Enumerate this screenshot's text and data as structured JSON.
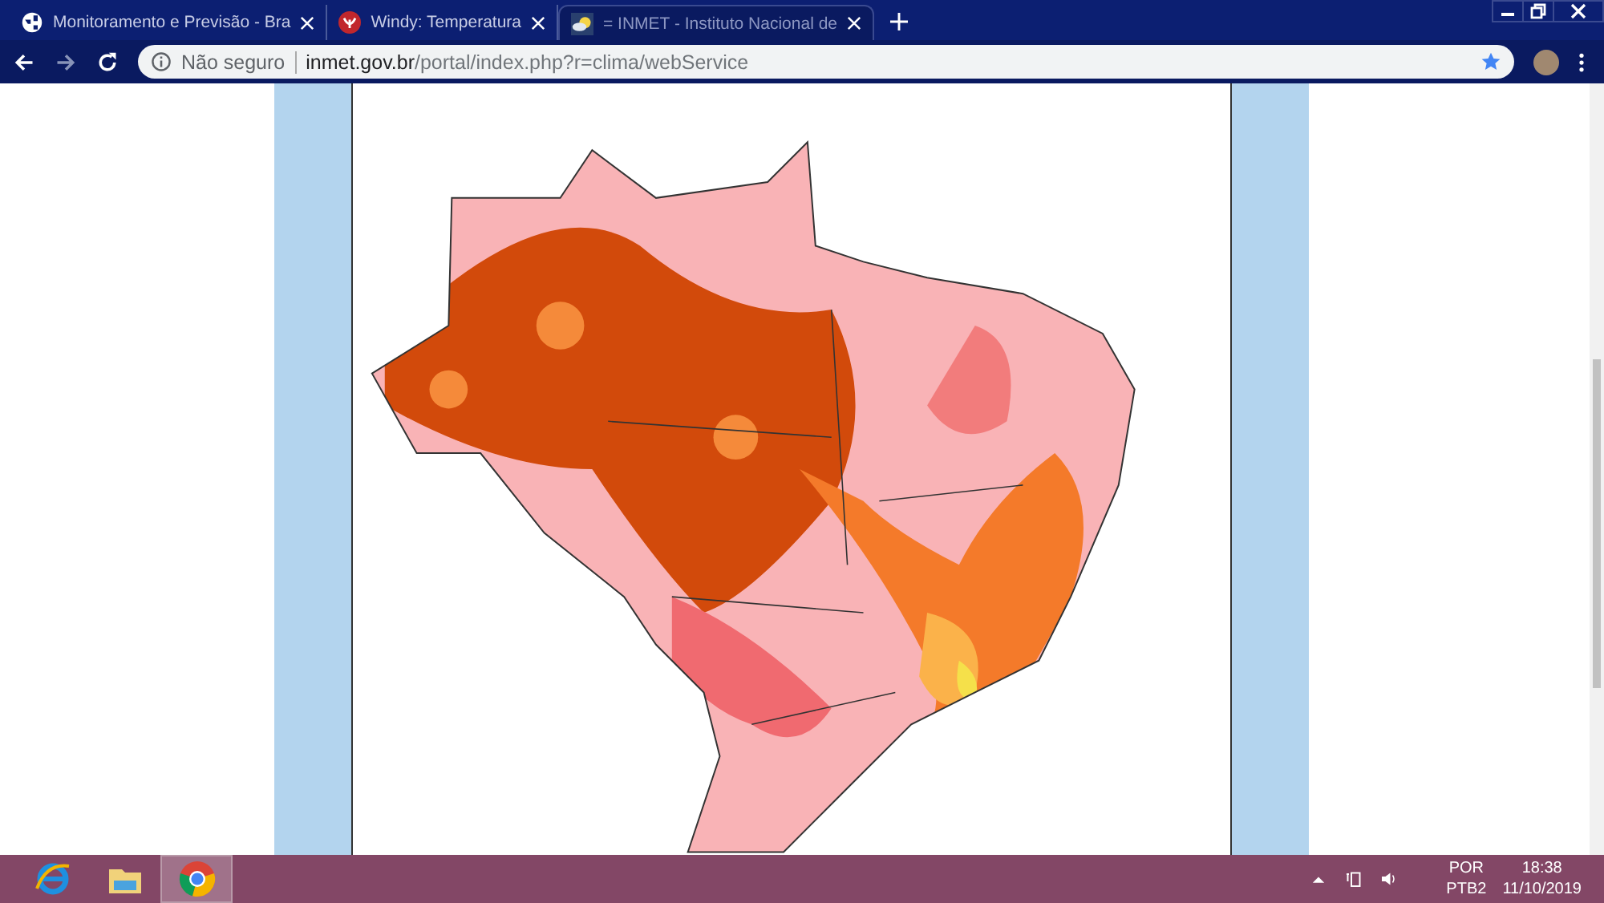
{
  "tabs": [
    {
      "title": "Monitoramento e Previsão - Bra",
      "kind": "globe",
      "selected": false
    },
    {
      "title": "Windy: Temperatura",
      "kind": "windy",
      "selected": false
    },
    {
      "title": "= INMET - Instituto Nacional de",
      "kind": "weather",
      "selected": true
    }
  ],
  "address_bar": {
    "security": "Não seguro",
    "domain": "inmet.gov.br",
    "path": "/portal/index.php?r=clima/webService"
  },
  "taskbar": {
    "apps": [
      {
        "kind": "ie",
        "selected": false
      },
      {
        "kind": "explorer",
        "selected": false
      },
      {
        "kind": "chrome",
        "selected": true
      }
    ],
    "language": "POR",
    "layout": "PTB2",
    "time": "18:38",
    "date": "11/10/2019"
  }
}
